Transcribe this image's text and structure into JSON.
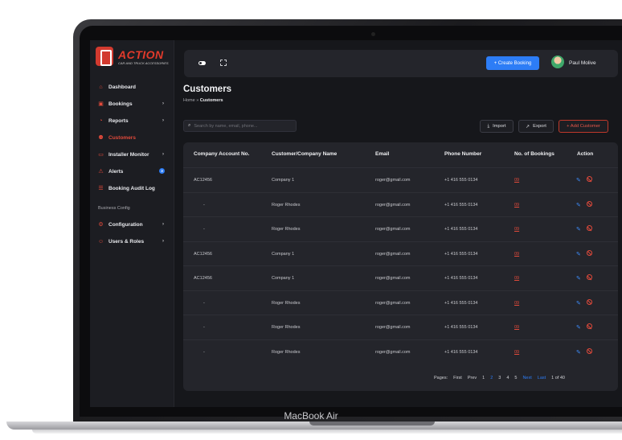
{
  "device_label": "MacBook Air",
  "brand": {
    "name": "ACTION",
    "tagline": "CAR AND TRUCK ACCESSORIES"
  },
  "sidebar": {
    "items": [
      {
        "label": "Dashboard",
        "icon": "home-icon",
        "chevron": false
      },
      {
        "label": "Bookings",
        "icon": "calendar-icon",
        "chevron": true
      },
      {
        "label": "Reports",
        "icon": "pie-chart-icon",
        "chevron": true
      },
      {
        "label": "Customers",
        "icon": "users-icon",
        "chevron": false,
        "active": true
      },
      {
        "label": "Installer Monitor",
        "icon": "monitor-icon",
        "chevron": true
      },
      {
        "label": "Alerts",
        "icon": "alert-icon",
        "badge": "3"
      },
      {
        "label": "Booking Audit Log",
        "icon": "log-icon",
        "chevron": false
      }
    ],
    "section_label": "Business Config",
    "config_items": [
      {
        "label": "Configuration",
        "icon": "gear-icon",
        "chevron": true
      },
      {
        "label": "Users & Roles",
        "icon": "user-roles-icon",
        "chevron": true
      }
    ]
  },
  "topbar": {
    "create_label": "+ Create Booking",
    "user_name": "Paul Molive"
  },
  "page": {
    "title": "Customers",
    "breadcrumb_home": "Home",
    "breadcrumb_sep": "»",
    "breadcrumb_current": "Customers"
  },
  "toolbar": {
    "search_placeholder": "Search by name, email, phone...",
    "import_label": "Import",
    "export_label": "Export",
    "add_label": "+ Add Customer"
  },
  "table": {
    "columns": [
      "Company Account No.",
      "Customer/Company Name",
      "Email",
      "Phone Number",
      "No. of Bookings",
      "Action"
    ],
    "rows": [
      [
        "AC12456",
        "Company 1",
        "roger@gmail.com",
        "+1 416 555 0134",
        "09"
      ],
      [
        "-",
        "Roger Rhodes",
        "roger@gmail.com",
        "+1 416 555 0134",
        "09"
      ],
      [
        "-",
        "Roger Rhodes",
        "roger@gmail.com",
        "+1 416 555 0134",
        "09"
      ],
      [
        "AC12456",
        "Company 1",
        "roger@gmail.com",
        "+1 416 555 0134",
        "09"
      ],
      [
        "AC12456",
        "Company 1",
        "roger@gmail.com",
        "+1 416 555 0134",
        "09"
      ],
      [
        "-",
        "Roger Rhodes",
        "roger@gmail.com",
        "+1 416 555 0134",
        "09"
      ],
      [
        "-",
        "Roger Rhodes",
        "roger@gmail.com",
        "+1 416 555 0134",
        "09"
      ],
      [
        "-",
        "Roger Rhodes",
        "roger@gmail.com",
        "+1 416 555 0134",
        "09"
      ]
    ]
  },
  "pagination": {
    "label": "Pages:",
    "first": "First",
    "prev": "Prev",
    "pages": [
      "1",
      "2",
      "3",
      "4",
      "5"
    ],
    "current": "2",
    "next": "Next",
    "last": "Last",
    "summary": "1 of 40"
  },
  "colors": {
    "accent": "#e24a3b",
    "primary": "#2d7df6",
    "background": "#16171b",
    "card": "#24252b"
  }
}
